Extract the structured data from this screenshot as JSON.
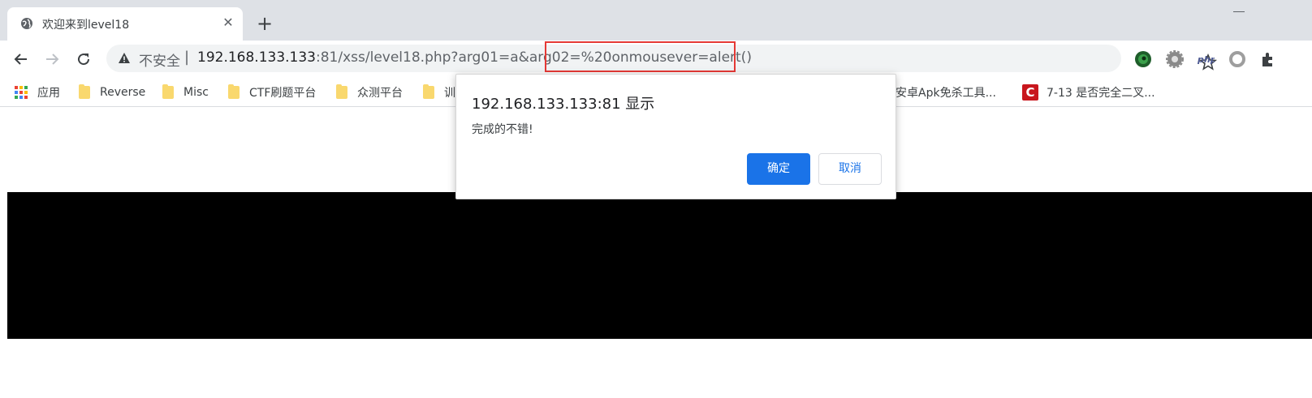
{
  "tab": {
    "title": "欢迎来到level18",
    "close": "✕"
  },
  "new_tab": "+",
  "omnibox": {
    "insecure_label": "不安全",
    "separator": "|",
    "url_host": "192.168.133.133",
    "url_path": ":81/xss/level18.php?arg01=a&arg02=%20onmousever=alert()"
  },
  "bookmarks": {
    "apps": "应用",
    "items": [
      "Reverse",
      "Misc",
      "CTF刷题平台",
      "众测平台",
      "训",
      "安卓Apk免杀工具...",
      "7-13 是否完全二叉..."
    ]
  },
  "dialog": {
    "title": "192.168.133.133:81 显示",
    "message": "完成的不错!",
    "ok": "确定",
    "cancel": "取消"
  },
  "colors": {
    "accent": "#1a73e8",
    "highlight": "#e53935",
    "csdn": "#c8161d",
    "folder": "#f9d86e"
  }
}
